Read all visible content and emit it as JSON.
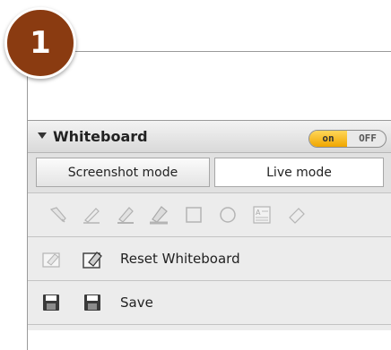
{
  "step": {
    "number": "1"
  },
  "panel": {
    "title": "Whiteboard",
    "toggle": {
      "on_label": "on",
      "off_label": "OFF",
      "state": "on"
    },
    "modes": {
      "screenshot_label": "Screenshot mode",
      "live_label": "Live mode",
      "active": "Live mode"
    },
    "tools": [
      "pointer-tool",
      "pen-tool",
      "marker-tool",
      "highlighter-tool",
      "rectangle-tool",
      "ellipse-tool",
      "text-box-tool",
      "eraser-tool"
    ],
    "actions": {
      "reset_label": "Reset Whiteboard",
      "save_label": "Save"
    }
  },
  "colors": {
    "badge": "#8a3b11",
    "toggle_on": "#f0a600",
    "panel_bg": "#ececec"
  }
}
